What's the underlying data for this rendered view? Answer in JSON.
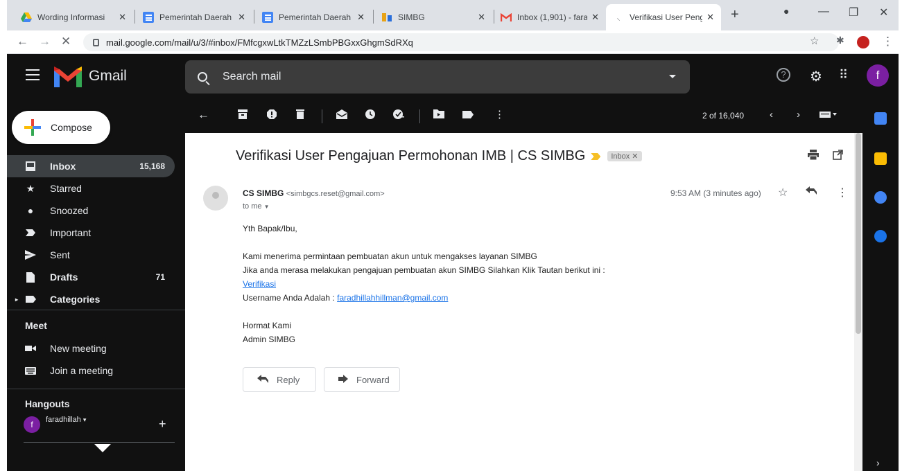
{
  "browser": {
    "tabs": [
      {
        "title": "Wording Informasi",
        "icon": "google-drive-icon"
      },
      {
        "title": "Pemerintah Daerah",
        "icon": "google-docs-icon"
      },
      {
        "title": "Pemerintah Daerah",
        "icon": "google-docs-icon"
      },
      {
        "title": "SIMBG",
        "icon": "simbg-icon"
      },
      {
        "title": "Inbox (1,901) - fara",
        "icon": "gmail-icon"
      },
      {
        "title": "Verifikasi User Peng",
        "icon": "loading-icon",
        "active": true
      }
    ],
    "url": "mail.google.com/mail/u/3/#inbox/FMfcgxwLtkTMZzLSmbPBGxxGhgmSdRXq"
  },
  "gmail": {
    "brand": "Gmail",
    "search_placeholder": "Search mail",
    "avatar_letter": "f",
    "compose_label": "Compose",
    "nav": [
      {
        "label": "Inbox",
        "count": "15,168",
        "icon": "inbox-icon"
      },
      {
        "label": "Starred",
        "count": "",
        "icon": "star-icon"
      },
      {
        "label": "Snoozed",
        "count": "",
        "icon": "clock-icon"
      },
      {
        "label": "Important",
        "count": "",
        "icon": "important-icon"
      },
      {
        "label": "Sent",
        "count": "",
        "icon": "send-icon"
      },
      {
        "label": "Drafts",
        "count": "71",
        "icon": "draft-icon"
      },
      {
        "label": "Categories",
        "count": "",
        "icon": "label-icon"
      }
    ],
    "meet": {
      "title": "Meet",
      "items": [
        "New meeting",
        "Join a meeting"
      ]
    },
    "hangouts": {
      "title": "Hangouts",
      "user": "faradhillah"
    },
    "pager": "2 of 16,040"
  },
  "message": {
    "subject": "Verifikasi User Pengajuan Permohonan IMB | CS SIMBG",
    "label": "Inbox",
    "sender_name": "CS SIMBG",
    "sender_email": "<simbgcs.reset@gmail.com>",
    "to": "to me",
    "time": "9:53 AM (3 minutes ago)",
    "greeting": "Yth Bapak/Ibu,",
    "line1": "Kami menerima permintaan pembuatan akun untuk mengakses layanan SIMBG",
    "line2": "Jika anda merasa melakukan pengajuan pembuatan akun SIMBG Silahkan Klik Tautan berikut ini :",
    "link": "Verifikasi",
    "username_label": "Username Anda Adalah :",
    "username_value": "faradhillahhillman@gmail.com",
    "closing1": "Hormat Kami",
    "closing2": "Admin SIMBG",
    "reply_label": "Reply",
    "forward_label": "Forward"
  },
  "colors": {
    "dark_bg": "#111111",
    "link": "#1a73e8",
    "avatar": "#7b1fa2",
    "important": "#f6bf26"
  }
}
